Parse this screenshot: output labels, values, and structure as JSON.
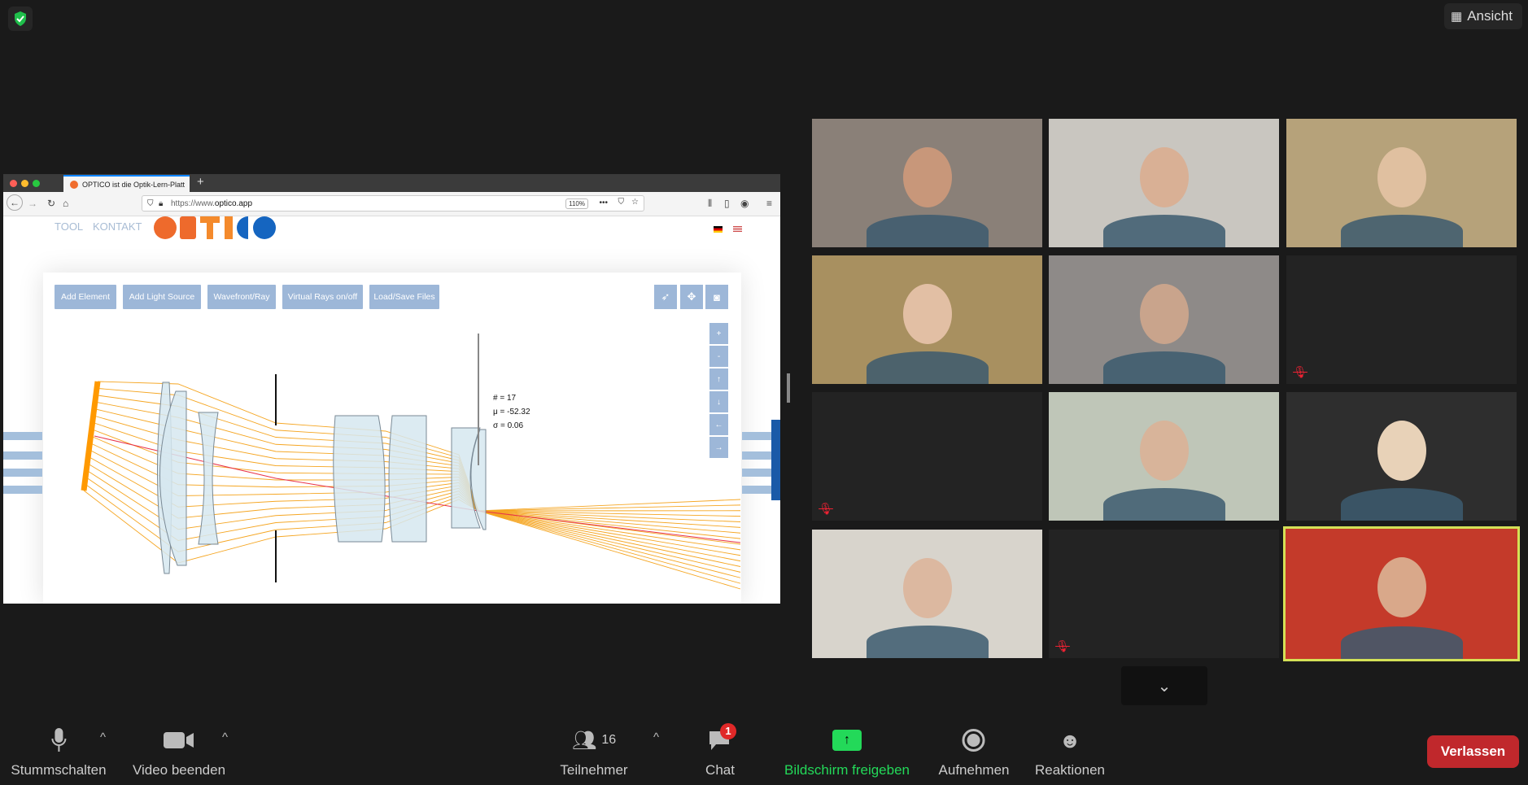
{
  "top": {
    "view_label": "Ansicht",
    "shield_icon": "shield-check-icon",
    "shield_color": "#1fbf4b"
  },
  "browser": {
    "tab_title": "OPTICO ist die Optik-Lern-Platt",
    "new_tab": "+",
    "url_prefix": "https://www.",
    "url_domain": "optico.app",
    "zoom": "110%",
    "site": {
      "nav": [
        "TOOL",
        "KONTAKT"
      ],
      "logo": "OPTICO",
      "toolbar": [
        "Add Element",
        "Add Light Source",
        "Wavefront/Ray",
        "Virtual Rays on/off",
        "Load/Save Files"
      ],
      "tool_icons": [
        "rocket-icon",
        "move-icon",
        "camera-icon"
      ],
      "view_buttons": [
        "+",
        "-",
        "↑",
        "↓",
        "←",
        "→"
      ],
      "stats": {
        "count": "# = 17",
        "mean": "μ = -52.32",
        "sigma": "σ = 0.06"
      },
      "ray_count": 17,
      "colors": {
        "button": "#9db7d8",
        "ray": "#f5a623",
        "chief_ray": "#e8334a",
        "lens": "#d6e8f0",
        "source": "#ff9900"
      }
    }
  },
  "gallery": {
    "tiles": [
      {
        "video": true,
        "muted": false
      },
      {
        "video": true,
        "muted": false
      },
      {
        "video": true,
        "muted": false
      },
      {
        "video": true,
        "muted": false
      },
      {
        "video": true,
        "muted": false
      },
      {
        "video": false,
        "muted": true
      },
      {
        "video": false,
        "muted": true
      },
      {
        "video": true,
        "muted": false
      },
      {
        "video": true,
        "muted": false
      },
      {
        "video": true,
        "muted": false
      },
      {
        "video": false,
        "muted": true
      },
      {
        "video": true,
        "muted": false,
        "active_speaker": true
      }
    ],
    "active_color": "#d4e157"
  },
  "toolbar": {
    "mute": "Stummschalten",
    "video": "Video beenden",
    "participants": "Teilnehmer",
    "participants_count": "16",
    "chat": "Chat",
    "chat_badge": "1",
    "share": "Bildschirm freigeben",
    "record": "Aufnehmen",
    "reactions": "Reaktionen",
    "leave": "Verlassen",
    "share_color": "#23d959",
    "leave_color": "#c0282c"
  }
}
